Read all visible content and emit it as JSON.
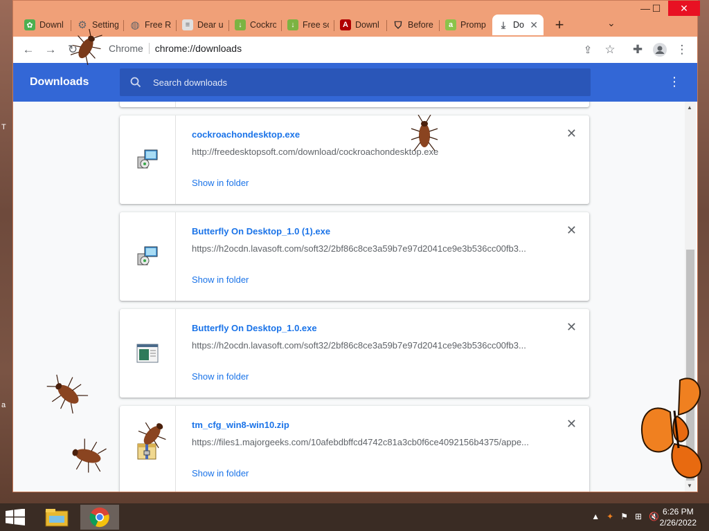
{
  "browser": {
    "tabs": [
      {
        "title": "Downl",
        "favicon": "plant-icon",
        "color": "#4caf50"
      },
      {
        "title": "Setting",
        "favicon": "gear-icon",
        "color": "#5f6368"
      },
      {
        "title": "Free R",
        "favicon": "globe-icon",
        "color": "#5f6368"
      },
      {
        "title": "Dear u",
        "favicon": "document-icon",
        "color": "#5f6368"
      },
      {
        "title": "Cockro",
        "favicon": "download-arrow-icon",
        "color": "#4caf50"
      },
      {
        "title": "Free sc",
        "favicon": "download-arrow-icon",
        "color": "#4caf50"
      },
      {
        "title": "Downl",
        "favicon": "adobe-icon",
        "color": "#b00000"
      },
      {
        "title": "Before",
        "favicon": "shield-icon",
        "color": "#202124"
      },
      {
        "title": "Promp",
        "favicon": "a-letter-icon",
        "color": "#8bc34a"
      },
      {
        "title": "Do",
        "favicon": "download-icon",
        "color": "#5f6368"
      }
    ],
    "site_label": "Chrome",
    "url": "chrome://downloads"
  },
  "downloads": {
    "title": "Downloads",
    "search_placeholder": "Search downloads",
    "items": [
      {
        "filename": "cockroachondesktop.exe",
        "url": "http://freedesktopsoft.com/download/cockroachondesktop.exe",
        "action": "Show in folder",
        "icon": "installer-icon"
      },
      {
        "filename": "Butterfly On Desktop_1.0 (1).exe",
        "url": "https://h2ocdn.lavasoft.com/soft32/2bf86c8ce3a59b7e97d2041ce9e3b536cc00fb3...",
        "action": "Show in folder",
        "icon": "installer-icon"
      },
      {
        "filename": "Butterfly On Desktop_1.0.exe",
        "url": "https://h2ocdn.lavasoft.com/soft32/2bf86c8ce3a59b7e97d2041ce9e3b536cc00fb3...",
        "action": "Show in folder",
        "icon": "window-file-icon"
      },
      {
        "filename": "tm_cfg_win8-win10.zip",
        "url": "https://files1.majorgeeks.com/10afebdbffcd4742c81a3cb0f6ce4092156b4375/appe...",
        "action": "Show in folder",
        "icon": "zip-icon"
      }
    ]
  },
  "taskbar": {
    "time": "6:26 PM",
    "date": "2/26/2022"
  },
  "desktop": {
    "edge_text_1": "T",
    "edge_text_2": "a"
  }
}
